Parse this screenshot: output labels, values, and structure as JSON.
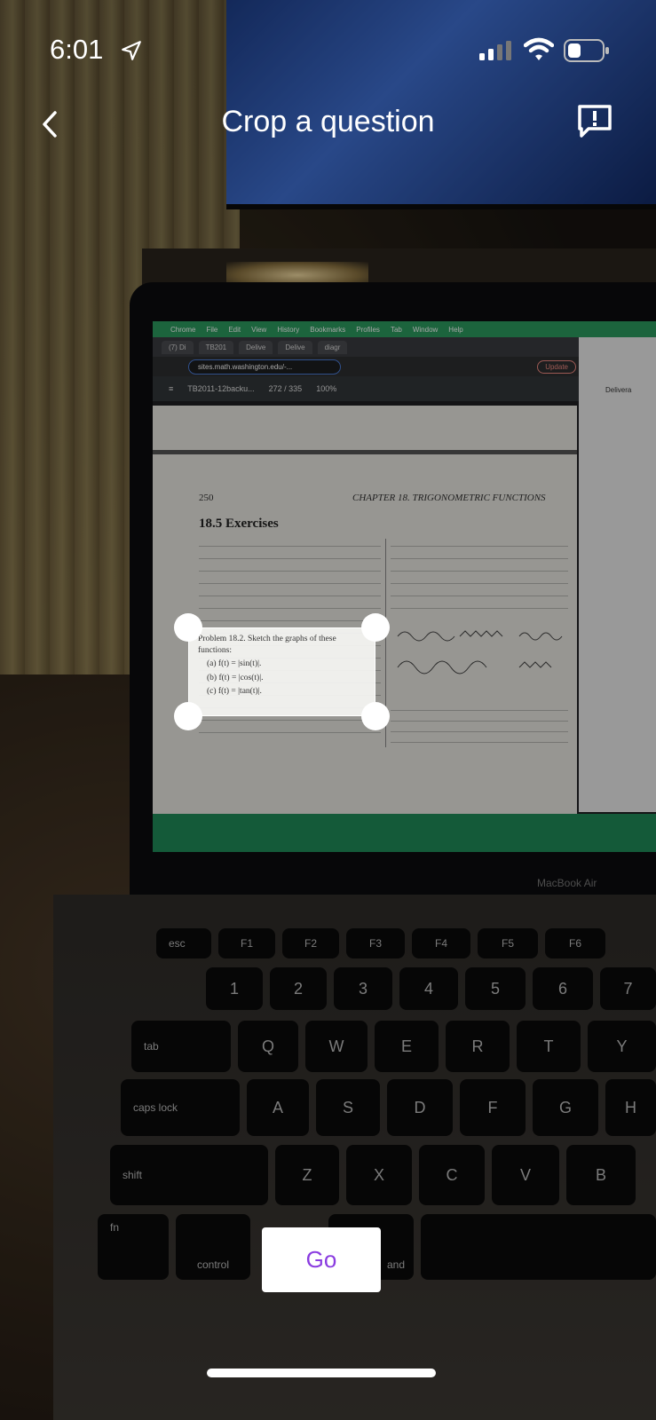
{
  "status_bar": {
    "time": "6:01"
  },
  "nav": {
    "title": "Crop a question"
  },
  "background_screen": {
    "menubar_items": [
      "Chrome",
      "File",
      "Edit",
      "View",
      "History",
      "Bookmarks",
      "Profiles",
      "Tab",
      "Window",
      "Help"
    ],
    "tabs": [
      "(7) Di",
      "TB201",
      "Delive",
      "Delive",
      "diagr"
    ],
    "url": "sites.math.washington.edu/-...",
    "update_label": "Update",
    "pdf_filename": "TB2011-12backu...",
    "pdf_pages": "272 / 335",
    "pdf_zoom": "100%",
    "page_number": "250",
    "chapter_title": "CHAPTER 18.  TRIGONOMETRIC FUNCTIONS",
    "section_title": "18.5   Exercises",
    "right_window_title": "Delivera",
    "laptop_label": "MacBook Air"
  },
  "crop": {
    "lines": [
      "Problem 18.2. Sketch the graphs of these functions:",
      "(a)  f(t) = |sin(t)|.",
      "(b)  f(t) = |cos(t)|.",
      "(c)  f(t) = |tan(t)|."
    ]
  },
  "go_label": "Go",
  "keyboard": {
    "keys": [
      "esc",
      "F1",
      "F2",
      "F3",
      "F4",
      "F5",
      "F6",
      "1",
      "2",
      "3",
      "4",
      "5",
      "6",
      "7",
      "tab",
      "Q",
      "W",
      "E",
      "R",
      "T",
      "Y",
      "caps lock",
      "A",
      "S",
      "D",
      "F",
      "G",
      "H",
      "shift",
      "Z",
      "X",
      "C",
      "V",
      "B",
      "fn",
      "control",
      "and"
    ]
  }
}
